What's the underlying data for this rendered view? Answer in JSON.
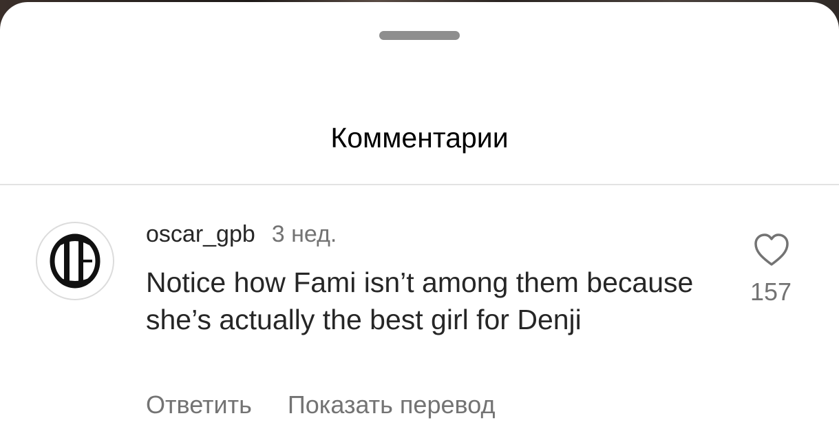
{
  "sheet": {
    "title": "Комментарии"
  },
  "comment": {
    "username": "oscar_gpb",
    "timestamp": "3 нед.",
    "text": "Notice how Fami isn’t among them because she’s actually the best girl for Denji",
    "avatar_icon": "gothic-letter-logo",
    "likes": "157",
    "actions": {
      "reply": "Ответить",
      "translate": "Показать перевод"
    }
  },
  "colors": {
    "background": "#ffffff",
    "primary_text": "#262626",
    "secondary_text": "#737373",
    "handle": "#8e8e8e",
    "divider": "#e3e3e3"
  }
}
